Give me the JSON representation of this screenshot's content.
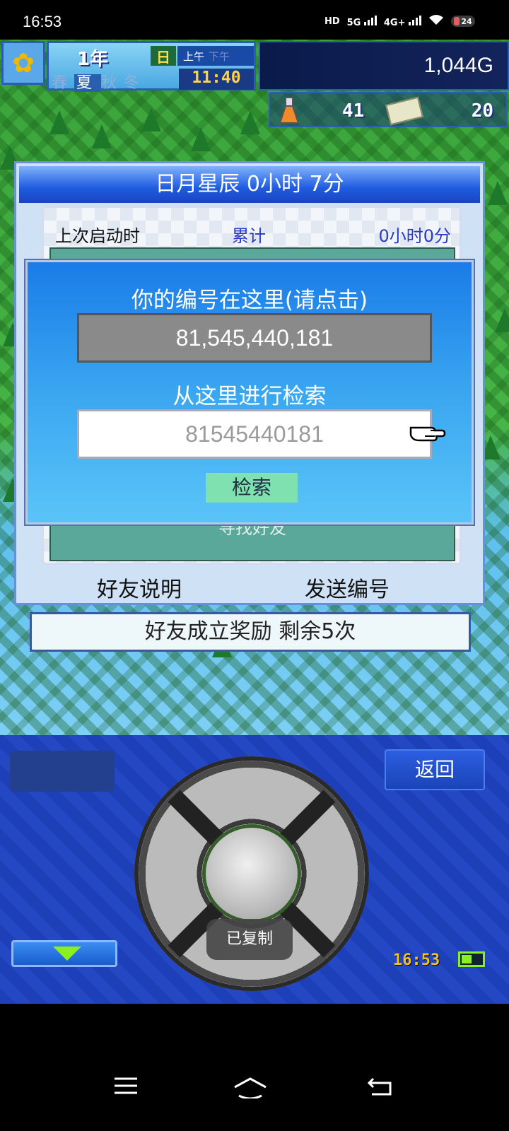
{
  "status_bar": {
    "time": "16:53",
    "network_labels": [
      "HD",
      "5G",
      "4G+"
    ],
    "battery_level": "24"
  },
  "hud": {
    "year": "1年",
    "weekday": "日",
    "am_label": "上午",
    "pm_label": "下午",
    "seasons": [
      "春",
      "夏",
      "秋",
      "冬"
    ],
    "current_season": "夏",
    "clock": "11:40",
    "money": "1,044G",
    "research_points": "41",
    "book_count": "20"
  },
  "panel": {
    "title": "日月星辰  0小时 7分",
    "last_launch_label": "上次启动时",
    "total_label": "累计",
    "total_value": "0小时0分",
    "find_friend_label": "寻找好友",
    "friend_info_label": "好友说明",
    "send_id_label": "发送编号"
  },
  "dialog": {
    "title": "你的编号在这里(请点击)",
    "id_value": "81,545,440,181",
    "search_label": "从这里进行检索",
    "search_placeholder": "81545440181",
    "search_button": "检索"
  },
  "reward": {
    "label": "好友成立奖励  剩余5次"
  },
  "controls": {
    "back_label": "返回",
    "toast": "已复制",
    "clock": "16:53"
  },
  "colors": {
    "dialog_top": "#1a7ce8",
    "dialog_bottom": "#5ac4f8",
    "panel_title": "#1f5be0",
    "teal_box": "#5aa89a",
    "search_button": "#7fe0b0"
  }
}
